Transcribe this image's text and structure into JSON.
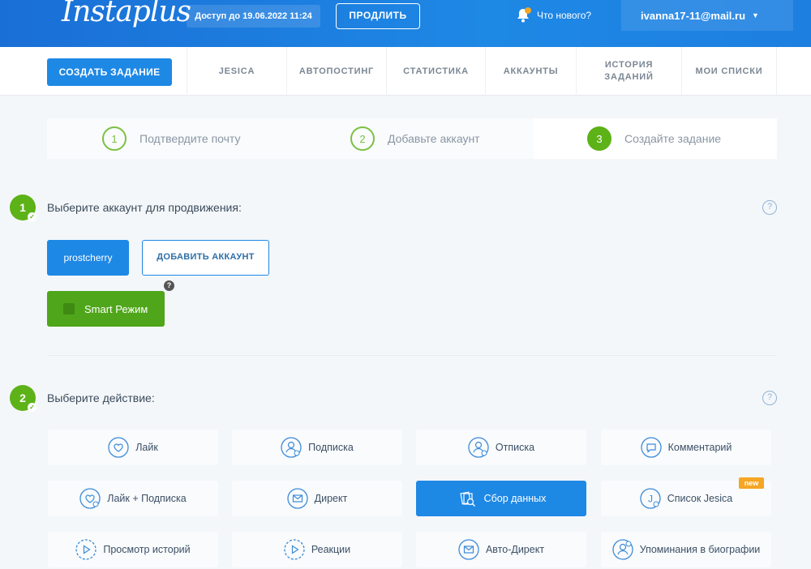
{
  "header": {
    "logo": "Instaplus",
    "access_text": "Доступ до 19.06.2022 11:24",
    "renew_label": "ПРОДЛИТЬ",
    "news_label": "Что нового?",
    "user_email": "ivanna17-11@mail.ru"
  },
  "nav": {
    "create_label": "СОЗДАТЬ ЗАДАНИЕ",
    "items": [
      "JESICA",
      "АВТОПОСТИНГ",
      "СТАТИСТИКА",
      "АККАУНТЫ",
      "ИСТОРИЯ ЗАДАНИЙ",
      "МОИ СПИСКИ"
    ]
  },
  "steps": [
    {
      "num": "1",
      "label": "Подтвердите почту"
    },
    {
      "num": "2",
      "label": "Добавьте аккаунт"
    },
    {
      "num": "3",
      "label": "Создайте задание"
    }
  ],
  "section1": {
    "num": "1",
    "title": "Выберите аккаунт для продвижения:",
    "account_label": "prostcherry",
    "add_account_label": "ДОБАВИТЬ АККАУНТ",
    "smart_label": "Smart Режим",
    "help": "?"
  },
  "section2": {
    "num": "2",
    "title": "Выберите действие:",
    "help": "?",
    "new_badge": "new",
    "actions": [
      "Лайк",
      "Подписка",
      "Отписка",
      "Комментарий",
      "Лайк + Подписка",
      "Директ",
      "Сбор данных",
      "Список Jesica",
      "Просмотр историй",
      "Реакции",
      "Авто-Директ",
      "Упоминания в биографии"
    ],
    "selected": "Сбор данных"
  },
  "colors": {
    "primary": "#1e88e5",
    "green": "#5cb217",
    "badge": "#f5a623"
  }
}
